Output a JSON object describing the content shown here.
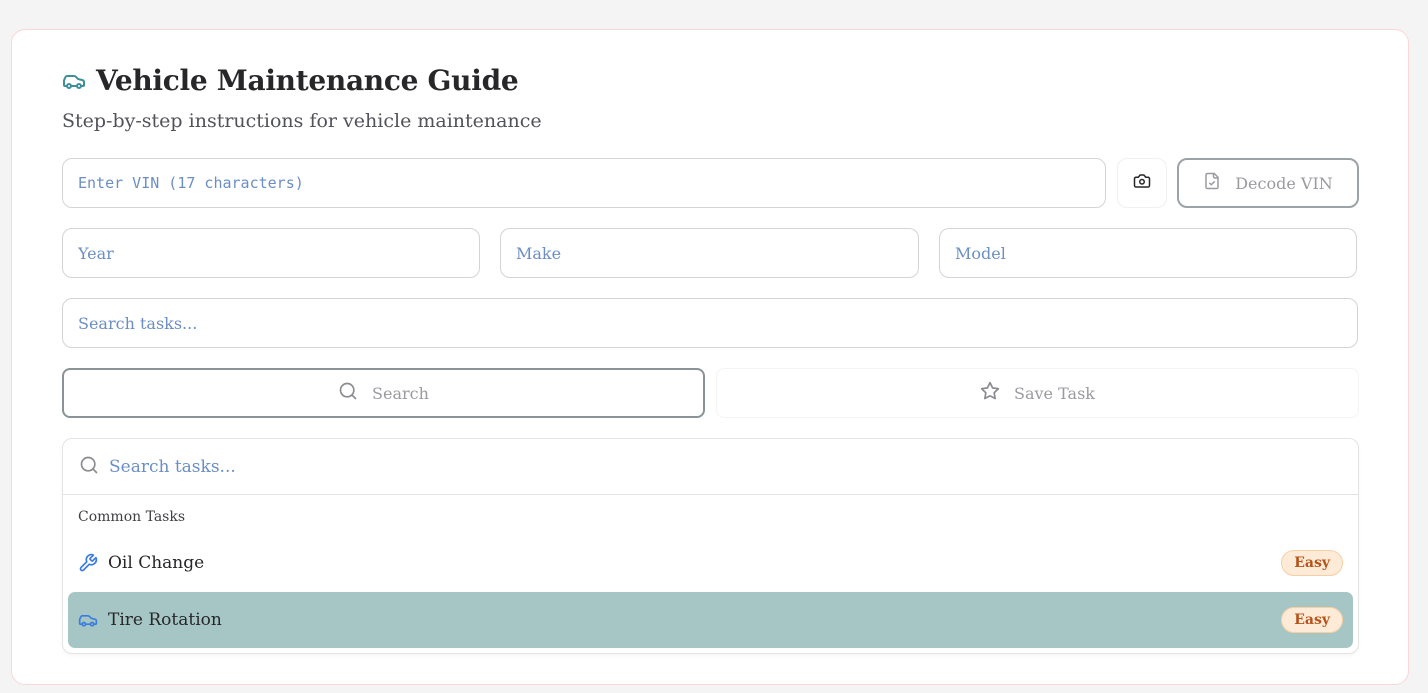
{
  "header": {
    "title": "Vehicle Maintenance Guide",
    "subtitle": "Step-by-step instructions for vehicle maintenance",
    "icon": "car-icon"
  },
  "vin": {
    "placeholder": "Enter VIN (17 characters)",
    "value": "",
    "camera_icon": "camera-icon",
    "decode_label": "Decode VIN",
    "decode_icon": "file-check-icon"
  },
  "vehicle": {
    "year_placeholder": "Year",
    "make_placeholder": "Make",
    "model_placeholder": "Model"
  },
  "search": {
    "placeholder": "Search tasks...",
    "search_button_label": "Search",
    "save_button_label": "Save Task"
  },
  "dropdown": {
    "search_placeholder": "Search tasks...",
    "group_label": "Common Tasks",
    "tasks": [
      {
        "label": "Oil Change",
        "icon": "wrench-icon",
        "difficulty": "Easy",
        "selected": false
      },
      {
        "label": "Tire Rotation",
        "icon": "car-icon",
        "difficulty": "Easy",
        "selected": true
      }
    ]
  },
  "colors": {
    "accent": "#3f8f99",
    "placeholder": "#6b8ec4",
    "selected_row": "#a5c6c4",
    "badge_bg": "#fdebd7",
    "badge_text": "#b4531b",
    "icon_blue": "#3b7ddd"
  }
}
